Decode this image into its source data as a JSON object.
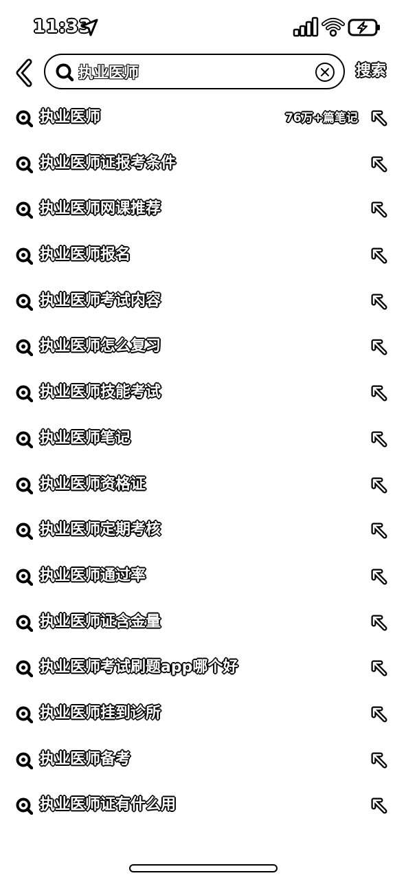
{
  "status_bar": {
    "time": "11:33",
    "icons": [
      "location-arrow-icon",
      "signal-icon",
      "wifi-icon",
      "battery-charging-icon"
    ]
  },
  "search": {
    "back_icon": "chevron-left-icon",
    "query": "执业医师",
    "search_icon": "search-icon",
    "clear_icon": "clear-circle-icon",
    "submit_label": "搜索"
  },
  "suggestions": [
    {
      "label": "执业医师",
      "meta": "76万+篇笔记"
    },
    {
      "label": "执业医师证报考条件"
    },
    {
      "label": "执业医师网课推荐"
    },
    {
      "label": "执业医师报名"
    },
    {
      "label": "执业医师考试内容"
    },
    {
      "label": "执业医师怎么复习"
    },
    {
      "label": "执业医师技能考试"
    },
    {
      "label": "执业医师笔记"
    },
    {
      "label": "执业医师资格证"
    },
    {
      "label": "执业医师定期考核"
    },
    {
      "label": "执业医师通过率"
    },
    {
      "label": "执业医师证含金量"
    },
    {
      "label": "执业医师考试刷题app哪个好"
    },
    {
      "label": "执业医师挂到诊所"
    },
    {
      "label": "执业医师备考"
    },
    {
      "label": "执业医师证有什么用"
    }
  ]
}
